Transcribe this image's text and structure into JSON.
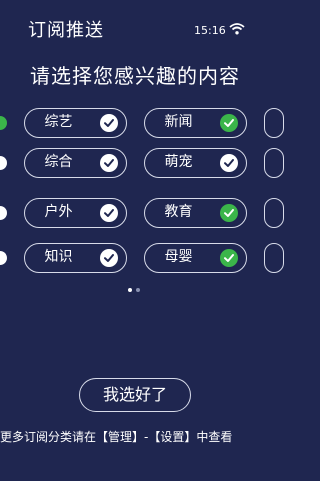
{
  "header": {
    "title": "订阅推送"
  },
  "status_bar": {
    "time": "15:16",
    "wifi_icon": "wifi-icon"
  },
  "headline": "请选择您感兴趣的内容",
  "rows": [
    {
      "left": {
        "label": "综艺",
        "check_color": "#ffffff"
      },
      "right": {
        "label": "新闻",
        "check_color": "#3bb54a"
      }
    },
    {
      "left": {
        "label": "综合",
        "check_color": "#ffffff"
      },
      "right": {
        "label": "萌宠",
        "check_color": "#ffffff"
      }
    },
    {
      "left": {
        "label": "户外",
        "check_color": "#ffffff"
      },
      "right": {
        "label": "教育",
        "check_color": "#3bb54a"
      }
    },
    {
      "left": {
        "label": "知识",
        "check_color": "#ffffff"
      },
      "right": {
        "label": "母婴",
        "check_color": "#3bb54a"
      }
    }
  ],
  "pagination": {
    "pages": 2,
    "current": 1
  },
  "confirm_button": "我选好了",
  "footer_note": "更多订阅分类请在【管理】-【设置】中查看",
  "colors": {
    "background": "#1f2650",
    "accent_green": "#3bb54a",
    "outline": "#d7dbe9"
  }
}
